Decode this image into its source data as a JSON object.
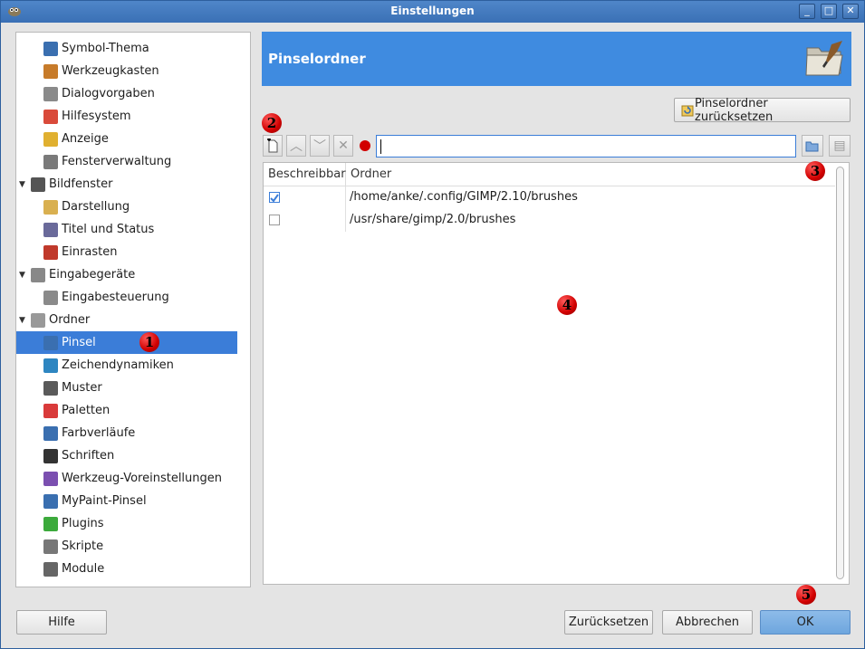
{
  "window": {
    "title": "Einstellungen"
  },
  "sidebar": {
    "items": [
      {
        "label": "Symbol-Thema",
        "icon": "symbol-theme-icon",
        "level": 1
      },
      {
        "label": "Werkzeugkasten",
        "icon": "toolbox-icon",
        "level": 1
      },
      {
        "label": "Dialogvorgaben",
        "icon": "dialog-defaults-icon",
        "level": 1
      },
      {
        "label": "Hilfesystem",
        "icon": "help-lifebuoy-icon",
        "level": 1
      },
      {
        "label": "Anzeige",
        "icon": "display-icon",
        "level": 1
      },
      {
        "label": "Fensterverwaltung",
        "icon": "window-management-icon",
        "level": 1
      },
      {
        "label": "Bildfenster",
        "icon": "image-window-icon",
        "level": 0,
        "expanded": true
      },
      {
        "label": "Darstellung",
        "icon": "appearance-icon",
        "level": 1
      },
      {
        "label": "Titel und Status",
        "icon": "title-status-icon",
        "level": 1
      },
      {
        "label": "Einrasten",
        "icon": "snap-icon",
        "level": 1
      },
      {
        "label": "Eingabegeräte",
        "icon": "input-devices-icon",
        "level": 0,
        "expanded": true
      },
      {
        "label": "Eingabesteuerung",
        "icon": "input-controllers-icon",
        "level": 1
      },
      {
        "label": "Ordner",
        "icon": "folders-icon",
        "level": 0,
        "expanded": true
      },
      {
        "label": "Pinsel",
        "icon": "brush-icon",
        "level": 1,
        "selected": true
      },
      {
        "label": "Zeichendynamiken",
        "icon": "paint-dynamics-icon",
        "level": 1
      },
      {
        "label": "Muster",
        "icon": "pattern-icon",
        "level": 1
      },
      {
        "label": "Paletten",
        "icon": "palette-icon",
        "level": 1
      },
      {
        "label": "Farbverläufe",
        "icon": "gradient-icon",
        "level": 1
      },
      {
        "label": "Schriften",
        "icon": "fonts-icon",
        "level": 1
      },
      {
        "label": "Werkzeug-Voreinstellungen",
        "icon": "tool-presets-icon",
        "level": 1
      },
      {
        "label": "MyPaint-Pinsel",
        "icon": "mypaint-brush-icon",
        "level": 1
      },
      {
        "label": "Plugins",
        "icon": "plugins-icon",
        "level": 1
      },
      {
        "label": "Skripte",
        "icon": "scripts-icon",
        "level": 1
      },
      {
        "label": "Module",
        "icon": "modules-icon",
        "level": 1
      }
    ]
  },
  "panel": {
    "title": "Pinselordner",
    "reset_button": "Pinselordner zurücksetzen",
    "path_value": "",
    "table": {
      "headers": [
        "Beschreibbar",
        "Ordner"
      ],
      "rows": [
        {
          "writable": true,
          "folder": "/home/anke/.config/GIMP/2.10/brushes"
        },
        {
          "writable": false,
          "folder": "/usr/share/gimp/2.0/brushes"
        }
      ]
    }
  },
  "markers": [
    "1",
    "2",
    "3",
    "4",
    "5"
  ],
  "footer": {
    "help": "Hilfe",
    "reset": "Zurücksetzen",
    "cancel": "Abbrechen",
    "ok": "OK"
  },
  "colors": {
    "accent": "#3b7dd8",
    "banner": "#3f8be0",
    "titlebar": "#3a70b5",
    "marker": "#d10000"
  }
}
